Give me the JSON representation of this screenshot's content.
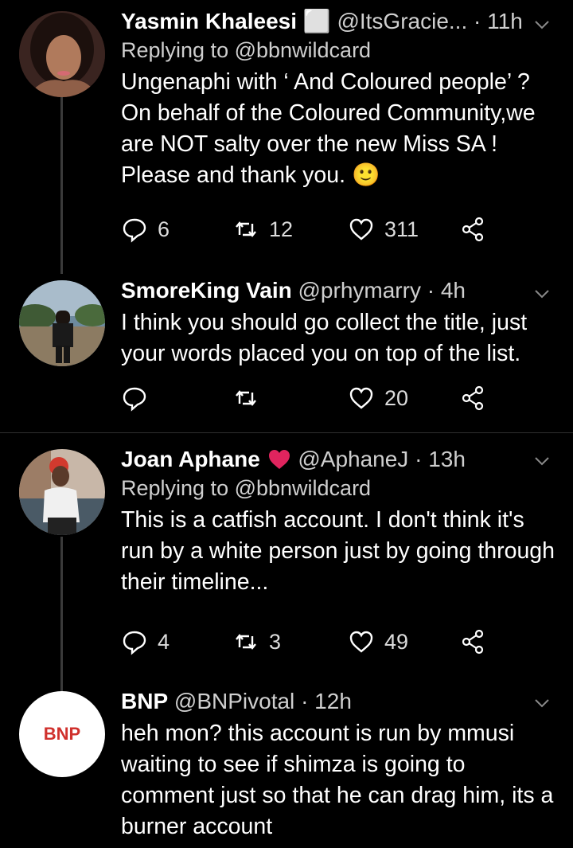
{
  "tweets": [
    {
      "name": "Yasmin Khaleesi ⬜",
      "handle": "@ItsGracie...",
      "sep": "·",
      "time": "11h",
      "replying": "Replying to @bbnwildcard",
      "text": "Ungenaphi with ‘ And Coloured people’ ? On behalf of the Coloured Community,we are NOT salty over the new Miss SA ! Please and thank you. 🙂",
      "reply_count": "6",
      "retweet_count": "12",
      "like_count": "311"
    },
    {
      "name": "SmoreKing Vain",
      "handle": "@prhymarry",
      "sep": "·",
      "time": "4h",
      "text": "I think you should go collect the title, just your words placed you on top of the list.",
      "reply_count": "",
      "retweet_count": "",
      "like_count": "20"
    },
    {
      "name": "Joan Aphane",
      "handle": "@AphaneJ",
      "sep": "·",
      "time": "13h",
      "replying": "Replying to @bbnwildcard",
      "text": "This is a catfish account. I don't think it's run by a white person just by going through their timeline...",
      "reply_count": "4",
      "retweet_count": "3",
      "like_count": "49"
    },
    {
      "name": "BNP",
      "handle": "@BNPivotal",
      "sep": "·",
      "time": "12h",
      "text": "heh mon? this account is run by mmusi waiting to see if shimza is going to comment just so that he can drag him, its a burner account",
      "avatar_text": "BNP"
    }
  ],
  "icons": [
    "reply-icon",
    "retweet-icon",
    "like-icon",
    "share-icon",
    "chevron-down-icon",
    "heart-emoji-icon"
  ],
  "colors": {
    "background": "#000000",
    "text": "#ffffff",
    "muted": "#cfcfcf",
    "thread": "#3a3a3a",
    "heart": "#e0245e",
    "bnp_red": "#d0312d"
  }
}
